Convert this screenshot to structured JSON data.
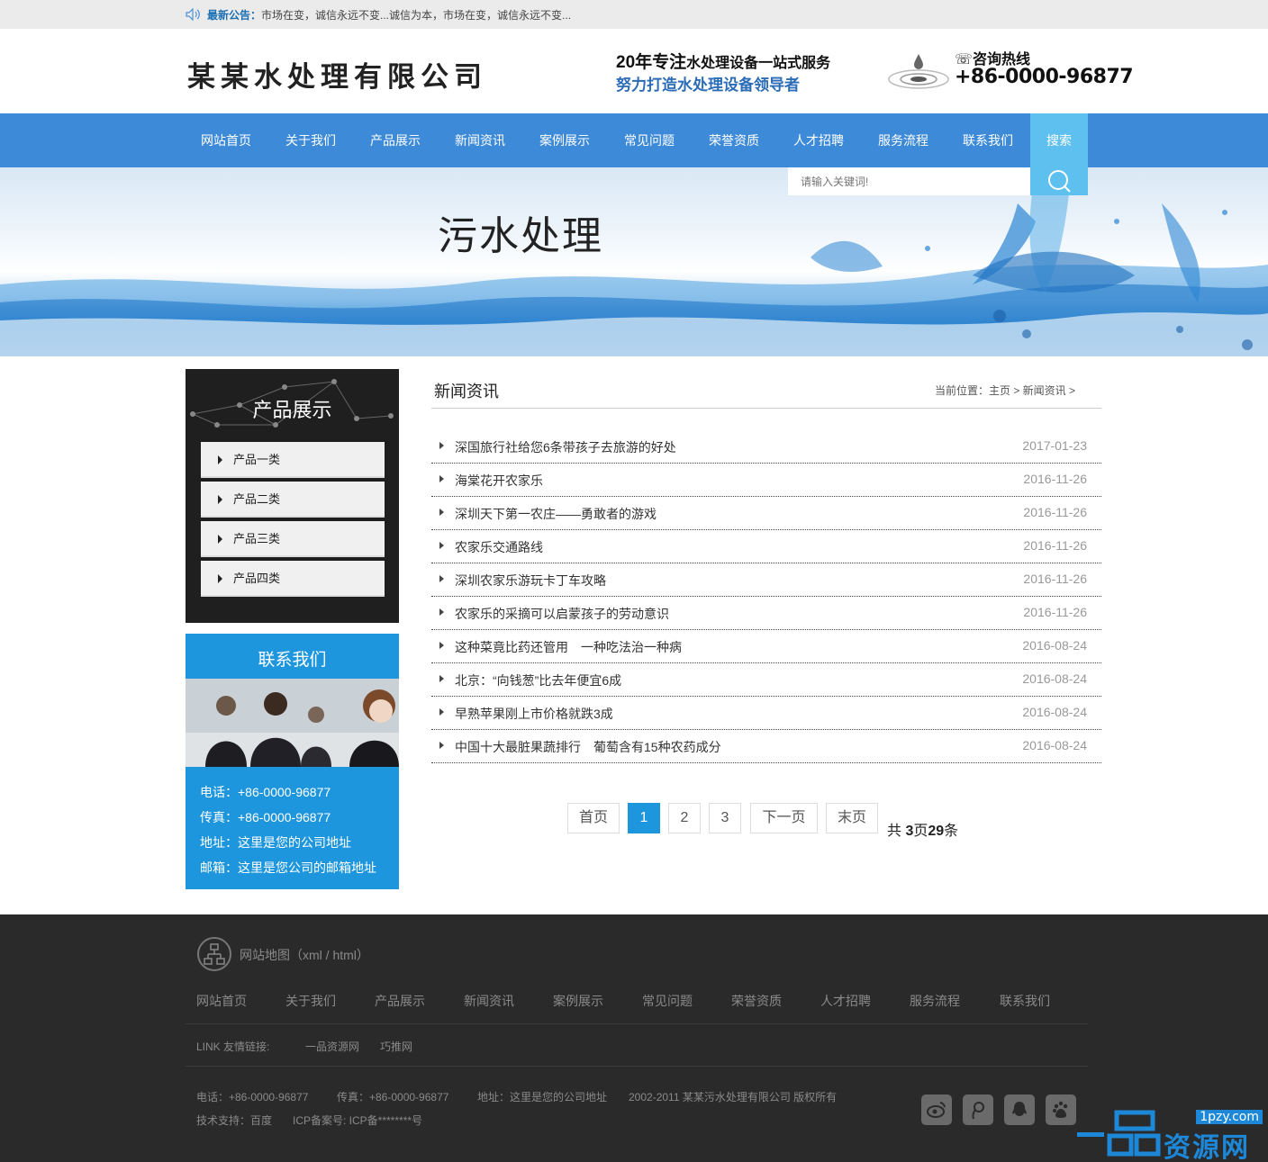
{
  "notice": {
    "label": "最新公告：",
    "text": "市场在变，诚信永远不变...诚信为本，市场在变，诚信永远不变..."
  },
  "header": {
    "logo_text": "某某水处理有限公司",
    "slogan_bold": "20年专注",
    "slogan_rest": "水处理设备一站式服务",
    "slogan2": "努力打造水处理设备领导者",
    "hotline_label": "咨询热线",
    "hotline_number": "+86-0000-96877"
  },
  "nav": {
    "items": [
      "网站首页",
      "关于我们",
      "产品展示",
      "新闻资讯",
      "案例展示",
      "常见问题",
      "荣誉资质",
      "人才招聘",
      "服务流程",
      "联系我们"
    ],
    "search_label": "搜索"
  },
  "banner": {
    "title": "污水处理",
    "search_placeholder": "请输入关键词!"
  },
  "sidebar": {
    "products_title": "产品展示",
    "categories": [
      "产品一类",
      "产品二类",
      "产品三类",
      "产品四类"
    ],
    "contact_title": "联系我们",
    "contact_lines": [
      "电话：+86-0000-96877",
      "传真：+86-0000-96877",
      "地址：这里是您的公司地址",
      "邮箱：这里是您公司的邮箱地址"
    ]
  },
  "main": {
    "title": "新闻资讯",
    "breadcrumb": "当前位置：主页 > 新闻资讯 >",
    "news": [
      {
        "title": "深国旅行社给您6条带孩子去旅游的好处",
        "date": "2017-01-23"
      },
      {
        "title": "海棠花开农家乐",
        "date": "2016-11-26"
      },
      {
        "title": "深圳天下第一农庄——勇敢者的游戏",
        "date": "2016-11-26"
      },
      {
        "title": "农家乐交通路线",
        "date": "2016-11-26"
      },
      {
        "title": "深圳农家乐游玩卡丁车攻略",
        "date": "2016-11-26"
      },
      {
        "title": "农家乐的采摘可以启蒙孩子的劳动意识",
        "date": "2016-11-26"
      },
      {
        "title": "这种菜竟比药还管用　一种吃法治一种病",
        "date": "2016-08-24"
      },
      {
        "title": "北京：“向钱葱”比去年便宜6成",
        "date": "2016-08-24"
      },
      {
        "title": "早熟苹果刚上市价格就跌3成",
        "date": "2016-08-24"
      },
      {
        "title": "中国十大最脏果蔬排行　葡萄含有15种农药成分",
        "date": "2016-08-24"
      }
    ],
    "pagination": {
      "first": "首页",
      "pages": [
        "1",
        "2",
        "3"
      ],
      "current": "1",
      "next": "下一页",
      "last": "末页",
      "total_prefix": "共 ",
      "total_pages": "3",
      "page_unit": "页",
      "total_items": "29",
      "item_unit": "条"
    }
  },
  "footer": {
    "sitemap": "网站地图（xml / html）",
    "nav": [
      "网站首页",
      "关于我们",
      "产品展示",
      "新闻资讯",
      "案例展示",
      "常见问题",
      "荣誉资质",
      "人才招聘",
      "服务流程",
      "联系我们"
    ],
    "links_label": "LINK 友情链接:",
    "links": [
      "一品资源网",
      "巧推网"
    ],
    "info_line1": [
      "电话：+86-0000-96877",
      "传真：+86-0000-96877",
      "地址：这里是您的公司地址",
      "2002-2011 某某污水处理有限公司 版权所有"
    ],
    "info_line2": [
      "技术支持：百度",
      "ICP备案号: ICP备********号"
    ],
    "social_icons": [
      "weibo-icon",
      "tencent-weibo-icon",
      "qq-icon",
      "baidu-icon"
    ]
  },
  "watermark": {
    "site": "1pzy.com",
    "name": "资源网"
  },
  "colors": {
    "nav": "#3d8ad8",
    "accent": "#5dc0ee",
    "contact": "#1e96dd",
    "footer": "#2a2a2a"
  }
}
